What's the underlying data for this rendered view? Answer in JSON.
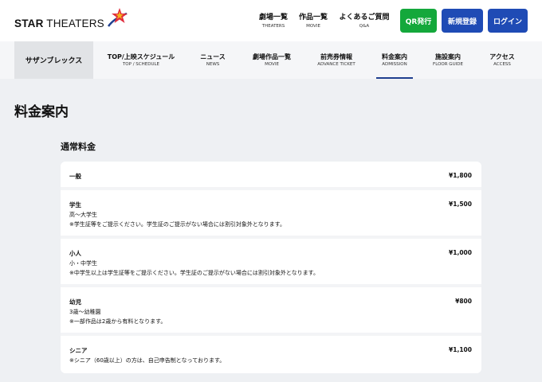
{
  "brand": {
    "name_bold": "STAR",
    "name_rest": " THEATERS"
  },
  "top_nav": [
    {
      "jp": "劇場一覧",
      "en": "THEATERS"
    },
    {
      "jp": "作品一覧",
      "en": "MOVIE"
    },
    {
      "jp": "よくあるご質問",
      "en": "Q&A"
    }
  ],
  "buttons": {
    "qr": "QR発行",
    "register": "新規登録",
    "login": "ログイン"
  },
  "theater_name": "サザンブレックス",
  "sub_nav": [
    {
      "jp": "TOP/上映スケジュール",
      "en": "TOP / SCHEDULE"
    },
    {
      "jp": "ニュース",
      "en": "NEWS"
    },
    {
      "jp": "劇場作品一覧",
      "en": "MOVIE"
    },
    {
      "jp": "前売券情報",
      "en": "ADVANCE TICKET"
    },
    {
      "jp": "料金案内",
      "en": "ADMISSION"
    },
    {
      "jp": "施設案内",
      "en": "FLOOR GUIDE"
    },
    {
      "jp": "アクセス",
      "en": "ACCESS"
    }
  ],
  "page_title": "料金案内",
  "section_title": "通常料金",
  "prices": [
    {
      "name": "一般",
      "price": "¥1,800",
      "lines": []
    },
    {
      "name": "学生",
      "price": "¥1,500",
      "lines": [
        "高〜大学生",
        "※学生証等をご提示ください。学生証のご提示がない場合には割引対象外となります。"
      ]
    },
    {
      "name": "小人",
      "price": "¥1,000",
      "lines": [
        "小・中学生",
        "※中学生以上は学生証等をご提示ください。学生証のご提示がない場合には割引対象外となります。"
      ]
    },
    {
      "name": "幼児",
      "price": "¥800",
      "lines": [
        "3歳〜幼稚園",
        "※一部作品は2歳から有料となります。"
      ]
    },
    {
      "name": "シニア",
      "price": "¥1,100",
      "lines": [
        "※シニア（60歳以上）の方は、自己申告制となっております。"
      ]
    }
  ],
  "colors": {
    "qr_button": "#14a83b",
    "primary_button": "#1f4bb5",
    "active_underline": "#1f3f8f"
  }
}
